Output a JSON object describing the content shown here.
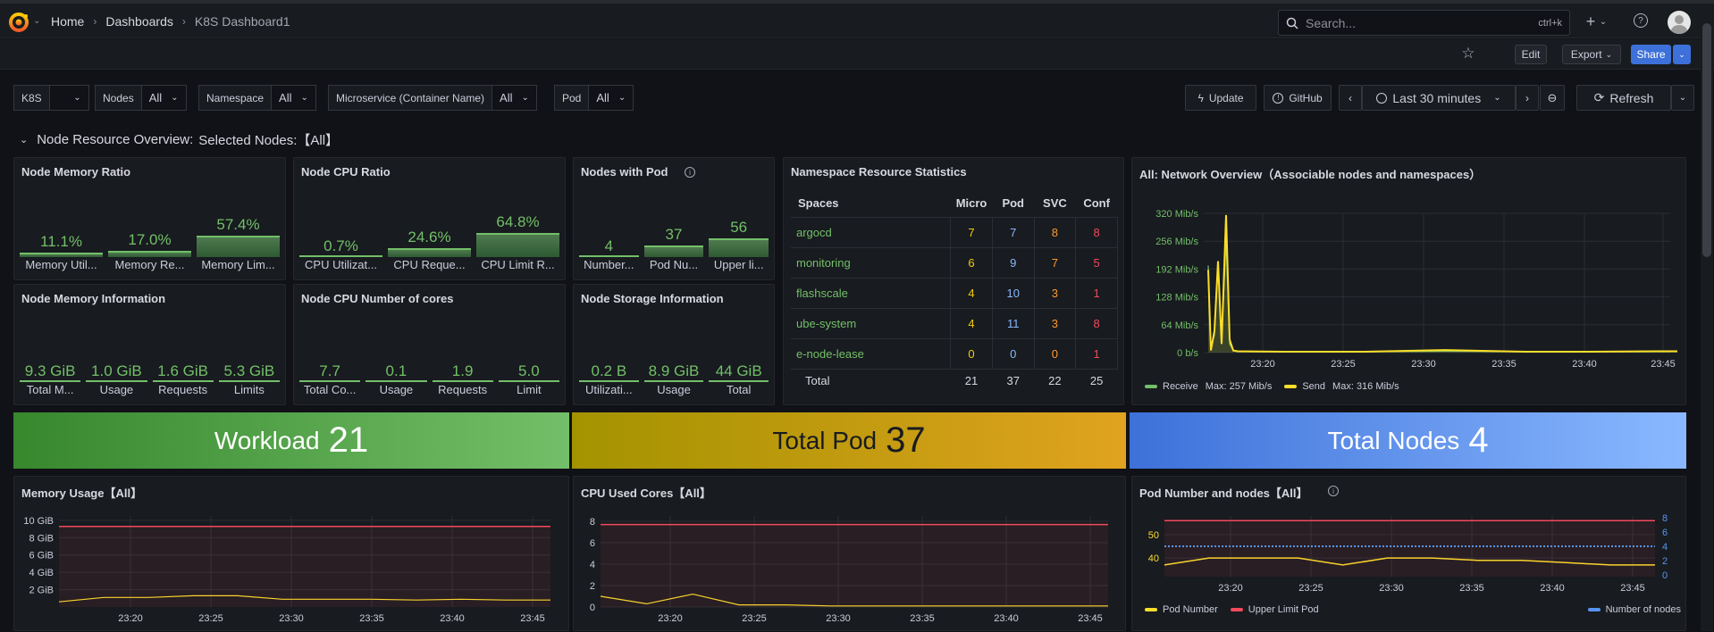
{
  "breadcrumbs": {
    "home": "Home",
    "dashboards": "Dashboards",
    "current": "K8S Dashboard1"
  },
  "search": {
    "placeholder": "Search...",
    "shortcut": "ctrl+k"
  },
  "toolbar": {
    "edit": "Edit",
    "export": "Export",
    "share": "Share"
  },
  "variables": [
    {
      "label": "K8S",
      "value": ""
    },
    {
      "label": "Nodes",
      "value": "All"
    },
    {
      "label": "Namespace",
      "value": "All"
    },
    {
      "label": "Microservice (Container Name)",
      "value": "All"
    },
    {
      "label": "Pod",
      "value": "All"
    }
  ],
  "controls": {
    "update": "Update",
    "github": "GitHub",
    "time_range": "Last 30 minutes",
    "refresh": "Refresh"
  },
  "row_header": {
    "title": "Node Resource Overview:",
    "subtitle": "Selected Nodes:【All】"
  },
  "panels": {
    "node_memory_ratio": {
      "title": "Node Memory Ratio",
      "gauges": [
        {
          "value": "11.1%",
          "fraction": 0.111,
          "label": "Memory Util..."
        },
        {
          "value": "17.0%",
          "fraction": 0.17,
          "label": "Memory Re..."
        },
        {
          "value": "57.4%",
          "fraction": 0.574,
          "label": "Memory Lim..."
        }
      ]
    },
    "node_cpu_ratio": {
      "title": "Node CPU Ratio",
      "gauges": [
        {
          "value": "0.7%",
          "fraction": 0.007,
          "label": "CPU Utilizat..."
        },
        {
          "value": "24.6%",
          "fraction": 0.246,
          "label": "CPU Reque..."
        },
        {
          "value": "64.8%",
          "fraction": 0.648,
          "label": "CPU Limit R..."
        }
      ]
    },
    "nodes_with_pod": {
      "title": "Nodes with Pod",
      "gauges": [
        {
          "value": "4",
          "fraction": 0.0,
          "label": "Number..."
        },
        {
          "value": "37",
          "fraction": 0.32,
          "label": "Pod Nu..."
        },
        {
          "value": "56",
          "fraction": 0.5,
          "label": "Upper li..."
        }
      ]
    },
    "node_memory_info": {
      "title": "Node Memory Information",
      "gauges": [
        {
          "value": "9.3 GiB",
          "label": "Total M..."
        },
        {
          "value": "1.0 GiB",
          "label": "Usage"
        },
        {
          "value": "1.6 GiB",
          "label": "Requests"
        },
        {
          "value": "5.3 GiB",
          "label": "Limits"
        }
      ]
    },
    "node_cpu_cores": {
      "title": "Node CPU Number of cores",
      "gauges": [
        {
          "value": "7.7",
          "label": "Total Co..."
        },
        {
          "value": "0.1",
          "label": "Usage"
        },
        {
          "value": "1.9",
          "label": "Requests"
        },
        {
          "value": "5.0",
          "label": "Limit"
        }
      ]
    },
    "node_storage_info": {
      "title": "Node Storage Information",
      "gauges": [
        {
          "value": "0.2 B",
          "label": "Utilizati..."
        },
        {
          "value": "8.9 GiB",
          "label": "Usage"
        },
        {
          "value": "44 GiB",
          "label": "Total"
        }
      ]
    },
    "namespace_stats": {
      "title": "Namespace Resource Statistics",
      "columns": [
        "Spaces",
        "Micro",
        "Pod",
        "SVC",
        "Conf"
      ],
      "rows": [
        {
          "space": "argocd",
          "micro": "7",
          "pod": "7",
          "svc": "8",
          "conf": "8"
        },
        {
          "space": "monitoring",
          "micro": "6",
          "pod": "9",
          "svc": "7",
          "conf": "5"
        },
        {
          "space": "flashscale",
          "micro": "4",
          "pod": "10",
          "svc": "3",
          "conf": "1"
        },
        {
          "space": "ube-system",
          "micro": "4",
          "pod": "11",
          "svc": "3",
          "conf": "8"
        },
        {
          "space": "e-node-lease",
          "micro": "0",
          "pod": "0",
          "svc": "0",
          "conf": "1"
        }
      ],
      "total": {
        "label": "Total",
        "micro": "21",
        "pod": "37",
        "svc": "22",
        "conf": "25"
      },
      "colors": {
        "micro": "#f2cc0c",
        "pod": "#8ab8ff",
        "svc": "#ff9830",
        "conf": "#f2495c"
      }
    },
    "network": {
      "title": "All: Network Overview（Associable nodes and namespaces）",
      "legend": [
        {
          "label": "Receive",
          "max": "Max: 257 Mib/s",
          "color": "#73bf69"
        },
        {
          "label": "Send",
          "max": "Max: 316 Mib/s",
          "color": "#fade2a"
        }
      ]
    },
    "workload": {
      "label": "Workload",
      "value": "21"
    },
    "total_pod": {
      "label": "Total Pod",
      "value": "37"
    },
    "total_nodes": {
      "label": "Total Nodes",
      "value": "4"
    },
    "memory_usage": {
      "title": "Memory Usage【All】"
    },
    "cpu_used": {
      "title": "CPU Used Cores【All】"
    },
    "pod_number": {
      "title": "Pod Number and nodes【All】",
      "legend": [
        {
          "label": "Pod Number",
          "color": "#fade2a"
        },
        {
          "label": "Upper Limit Pod",
          "color": "#f2495c"
        },
        {
          "label": "Number of nodes",
          "color": "#5794f2"
        }
      ]
    }
  },
  "chart_data": [
    {
      "type": "line",
      "title": "All: Network Overview（Associable nodes and namespaces）",
      "x": [
        "23:16",
        "23:17",
        "23:17.5",
        "23:18",
        "23:18.5",
        "23:19",
        "23:19.5",
        "23:20",
        "23:21",
        "23:25",
        "23:30",
        "23:34",
        "23:35",
        "23:40",
        "23:45",
        "23:45.5"
      ],
      "xticks": [
        "23:20",
        "23:25",
        "23:30",
        "23:35",
        "23:40",
        "23:45"
      ],
      "yticks": [
        "0 b/s",
        "64 Mib/s",
        "128 Mib/s",
        "192 Mib/s",
        "256 Mib/s",
        "320 Mib/s"
      ],
      "ylim": [
        0,
        320
      ],
      "series": [
        {
          "name": "Receive",
          "values": [
            200,
            10,
            40,
            200,
            30,
            257,
            20,
            5,
            2,
            2,
            2,
            3,
            2,
            2,
            2,
            2
          ]
        },
        {
          "name": "Send",
          "values": [
            190,
            5,
            50,
            210,
            20,
            316,
            30,
            5,
            3,
            2,
            2,
            6,
            2,
            2,
            3,
            3
          ]
        }
      ]
    },
    {
      "type": "line",
      "title": "Memory Usage【All】",
      "xticks": [
        "23:20",
        "23:25",
        "23:30",
        "23:35",
        "23:40",
        "23:45"
      ],
      "yticks": [
        "2 GiB",
        "4 GiB",
        "6 GiB",
        "8 GiB",
        "10 GiB"
      ],
      "ylim": [
        0,
        10.5
      ],
      "series": [
        {
          "name": "",
          "values": [
            0.6,
            1.1,
            1.1,
            1.3,
            1.3,
            0.9,
            0.9,
            0.9,
            0.8,
            0.9,
            0.8,
            0.8
          ]
        },
        {
          "name": "",
          "values": [
            9.3,
            9.3,
            9.3,
            9.3,
            9.3,
            9.3,
            9.3,
            9.3,
            9.3,
            9.3,
            9.3,
            9.3
          ]
        }
      ]
    },
    {
      "type": "line",
      "title": "CPU Used Cores【All】",
      "xticks": [
        "23:20",
        "23:25",
        "23:30",
        "23:35",
        "23:40",
        "23:45"
      ],
      "yticks": [
        "0",
        "2",
        "4",
        "6",
        "8"
      ],
      "ylim": [
        0,
        8.5
      ],
      "series": [
        {
          "name": "",
          "values": [
            1.0,
            0.3,
            1.2,
            0.2,
            0.2,
            0.1,
            0.1,
            0.1,
            0.1,
            0.1,
            0.1,
            0.1
          ]
        },
        {
          "name": "",
          "values": [
            7.7,
            7.7,
            7.7,
            7.7,
            7.7,
            7.7,
            7.7,
            7.7,
            7.7,
            7.7,
            7.7,
            7.7
          ]
        }
      ]
    },
    {
      "type": "line",
      "title": "Pod Number and nodes【All】",
      "xticks": [
        "23:20",
        "23:25",
        "23:30",
        "23:35",
        "23:40",
        "23:45"
      ],
      "yticks_left": [
        "40",
        "50"
      ],
      "yticks_right": [
        "0",
        "2",
        "4",
        "6",
        "8"
      ],
      "series": [
        {
          "name": "Pod Number",
          "values": [
            37,
            40,
            40,
            40,
            37,
            40,
            40,
            39,
            39,
            38,
            37,
            37
          ]
        },
        {
          "name": "Upper Limit Pod",
          "values": [
            56,
            56,
            56,
            56,
            56,
            56,
            56,
            56,
            56,
            56,
            56,
            56
          ]
        },
        {
          "name": "Number of nodes",
          "values": [
            4,
            4,
            4,
            4,
            4,
            4,
            4,
            4,
            4,
            4,
            4,
            4
          ]
        }
      ]
    }
  ]
}
